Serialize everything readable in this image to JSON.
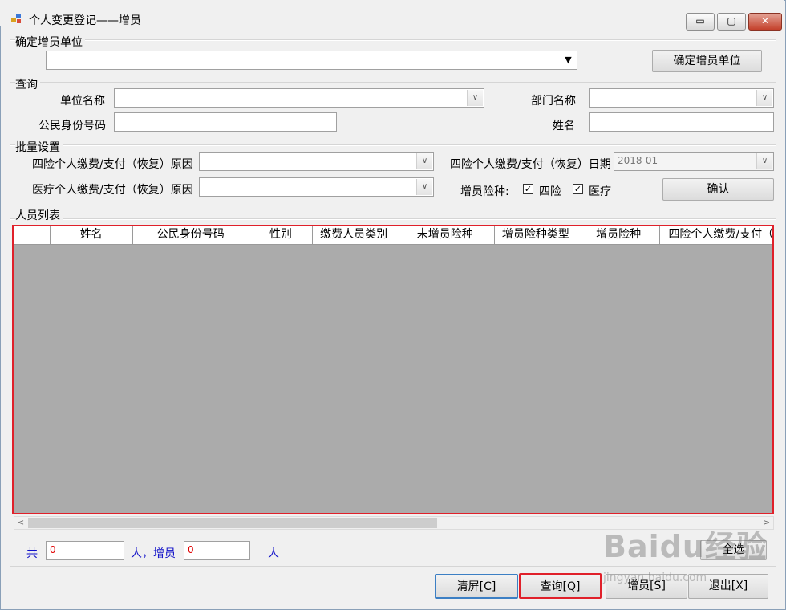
{
  "window": {
    "title": "个人变更登记——增员",
    "controls": {
      "minimize": "▭",
      "maximize": "▢",
      "close": "✕"
    }
  },
  "confirm_unit": {
    "group_label": "确定增员单位",
    "combo_value": "",
    "button_label": "确定增员单位"
  },
  "query": {
    "group_label": "查询",
    "unit_name_label": "单位名称",
    "unit_name_value": "",
    "dept_name_label": "部门名称",
    "dept_name_value": "",
    "id_label": "公民身份号码",
    "id_value": "",
    "name_label": "姓名",
    "name_value": ""
  },
  "batch": {
    "group_label": "批量设置",
    "four_reason_label": "四险个人缴费/支付（恢复）原因",
    "four_reason_value": "",
    "four_date_label": "四险个人缴费/支付（恢复）日期",
    "four_date_value": "2018-01",
    "medical_reason_label": "医疗个人缴费/支付（恢复）原因",
    "medical_reason_value": "",
    "insurance_label": "增员险种:",
    "insurance_options": [
      {
        "label": "四险",
        "checked": true
      },
      {
        "label": "医疗",
        "checked": true
      }
    ],
    "confirm_label": "确认"
  },
  "people": {
    "group_label": "人员列表",
    "columns": [
      "",
      "姓名",
      "公民身份号码",
      "性别",
      "缴费人员类别",
      "未增员险种",
      "增员险种类型",
      "增员险种",
      "四险个人缴费/支付（"
    ],
    "rows": [],
    "scroll_left": "<",
    "scroll_right": ">"
  },
  "footer": {
    "total_prefix": "共",
    "total_value": "0",
    "added_label": "人，增员",
    "added_value": "0",
    "person_suffix": "人",
    "select_all_label": "全选"
  },
  "buttons": {
    "clear": "清屏[C]",
    "query": "查询[Q]",
    "add": "增员[S]",
    "exit": "退出[X]"
  },
  "watermark": {
    "brand": "Baidu经验",
    "url": "jingyan.baidu.com"
  },
  "colors": {
    "highlight_border": "#e0202a",
    "footer_text": "#1010c8",
    "count_text": "#e00000",
    "grid_empty": "#ababab"
  }
}
